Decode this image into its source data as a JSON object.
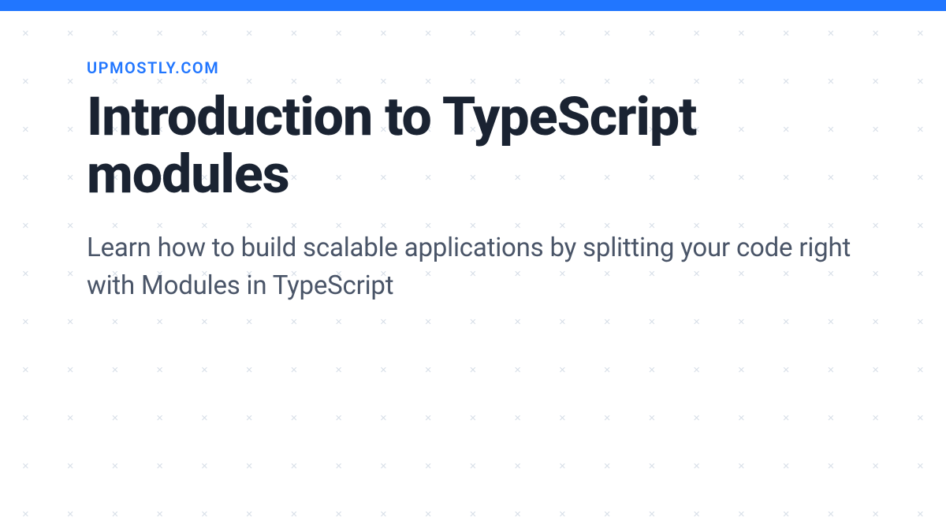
{
  "accent_color": "#2176ff",
  "header": {
    "site_name": "UPMOSTLY.COM"
  },
  "article": {
    "title": "Introduction to TypeScript modules",
    "description": "Learn how to build scalable applications by splitting your code right with Modules in TypeScript"
  },
  "pattern": {
    "glyph": "×",
    "rows": 11,
    "cols": 21
  }
}
